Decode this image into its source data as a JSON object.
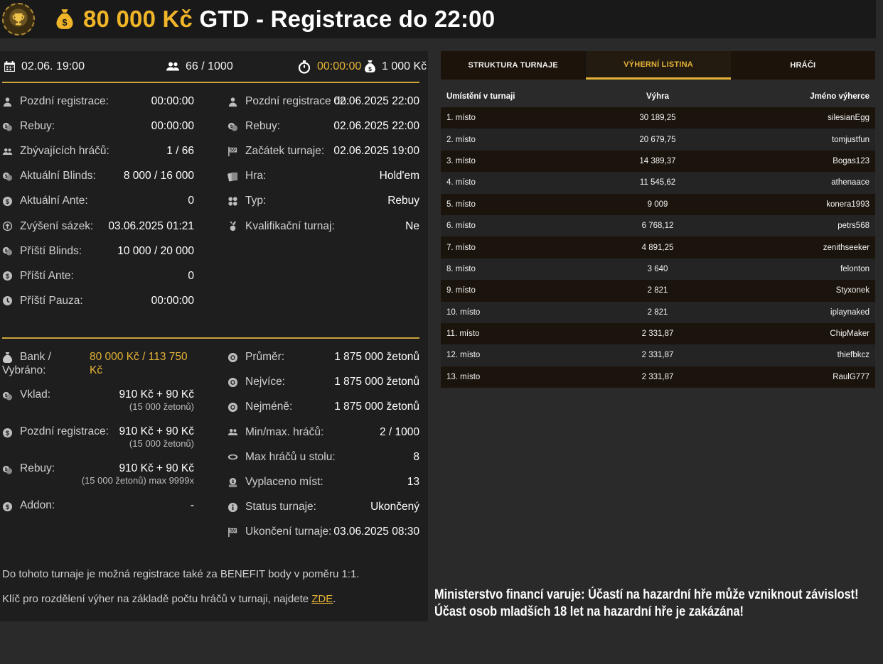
{
  "header": {
    "amount": "80 000 Kč",
    "rest": " GTD - Registrace do 22:00"
  },
  "summary": {
    "date": "02.06. 19:00",
    "players": "66 / 1000",
    "timer": "00:00:00",
    "buyin": "1 000 Kč"
  },
  "info_left": [
    {
      "icon": "person-icon",
      "label": "Pozdní registrace:",
      "value": "00:00:00"
    },
    {
      "icon": "coins-icon",
      "label": "Rebuy:",
      "value": "00:00:00"
    },
    {
      "icon": "users-icon",
      "label": "Zbývajících hráčů:",
      "value": "1 / 66"
    },
    {
      "icon": "coins-icon",
      "label": "Aktuální Blinds:",
      "value": "8 000 / 16 000"
    },
    {
      "icon": "coin-icon",
      "label": "Aktuální Ante:",
      "value": "0"
    },
    {
      "icon": "clock-up-icon",
      "label": "Zvýšení sázek:",
      "value": "03.06.2025 01:21"
    },
    {
      "icon": "coins-icon",
      "label": "Příští Blinds:",
      "value": "10 000 / 20 000"
    },
    {
      "icon": "coin-icon",
      "label": "Příští Ante:",
      "value": "0"
    },
    {
      "icon": "clock-icon",
      "label": "Příští Pauza:",
      "value": "00:00:00"
    }
  ],
  "info_right": [
    {
      "icon": "person-icon",
      "label": "Pozdní registrace do:",
      "value": "02.06.2025 22:00"
    },
    {
      "icon": "coins-icon",
      "label": "Rebuy:",
      "value": "02.06.2025 22:00"
    },
    {
      "icon": "flag-icon",
      "label": "Začátek turnaje:",
      "value": "02.06.2025 19:00"
    },
    {
      "icon": "cards-icon",
      "label": "Hra:",
      "value": "Hold'em"
    },
    {
      "icon": "suits-icon",
      "label": "Typ:",
      "value": "Rebuy"
    },
    {
      "icon": "medal-icon",
      "label": "Kvalifikační turnaj:",
      "value": "Ne"
    }
  ],
  "bank": {
    "label1": "Bank /",
    "label2": "Vybráno:",
    "value1": "80 000 Kč / 113 750",
    "value2": "Kč"
  },
  "fees": [
    {
      "icon": "coins-icon",
      "label": "Vklad:",
      "value": "910 Kč + 90 Kč",
      "sub": "(15 000 žetonů)"
    },
    {
      "icon": "coin-icon",
      "label": "Pozdní registrace:",
      "value": "910 Kč + 90 Kč",
      "sub": "(15 000 žetonů)"
    },
    {
      "icon": "coins-icon",
      "label": "Rebuy:",
      "value": "910 Kč + 90 Kč",
      "sub": "(15 000 žetonů) max 9999x"
    },
    {
      "icon": "coin-icon",
      "label": "Addon:",
      "value": "-",
      "sub": ""
    }
  ],
  "stats": [
    {
      "icon": "chip-icon",
      "label": "Průměr:",
      "value": "1 875 000 žetonů"
    },
    {
      "icon": "chip-icon",
      "label": "Nejvíce:",
      "value": "1 875 000 žetonů"
    },
    {
      "icon": "chip-icon",
      "label": "Nejméně:",
      "value": "1 875 000 žetonů"
    },
    {
      "icon": "users-icon",
      "label": "Min/max. hráčů:",
      "value": "2 / 1000"
    },
    {
      "icon": "table-icon",
      "label": "Max hráčů u stolu:",
      "value": "8"
    },
    {
      "icon": "payout-icon",
      "label": "Vyplaceno míst:",
      "value": "13"
    },
    {
      "icon": "info-icon",
      "label": "Status turnaje:",
      "value": "Ukončený"
    },
    {
      "icon": "flag-icon",
      "label": "Ukončení turnaje:",
      "value": "03.06.2025 08:30"
    }
  ],
  "notes": {
    "benefit": "Do tohoto turnaje je možná registrace také za BENEFIT body v poměru 1:1.",
    "key_text": "Klíč pro rozdělení výher na základě počtu hráčů v turnaji, najdete ",
    "key_link": "ZDE",
    "key_end": "."
  },
  "tabs": [
    "STRUKTURA TURNAJE",
    "VÝHERNÍ LISTINA",
    "HRÁČI"
  ],
  "table": {
    "headers": [
      "Umístění v turnaji",
      "Výhra",
      "Jméno výherce"
    ],
    "rows": [
      [
        "1. místo",
        "30 189,25",
        "silesianEgg"
      ],
      [
        "2. místo",
        "20 679,75",
        "tomjustfun"
      ],
      [
        "3. místo",
        "14 389,37",
        "Bogas123"
      ],
      [
        "4. místo",
        "11 545,62",
        "athenaace"
      ],
      [
        "5. místo",
        "9 009",
        "konera1993"
      ],
      [
        "6. místo",
        "6 768,12",
        "petrs568"
      ],
      [
        "7. místo",
        "4 891,25",
        "zenithseeker"
      ],
      [
        "8. místo",
        "3 640",
        "felonton"
      ],
      [
        "9. místo",
        "2 821",
        "Styxonek"
      ],
      [
        "10. místo",
        "2 821",
        "iplaynaked"
      ],
      [
        "11. místo",
        "2 331,87",
        "ChipMaker"
      ],
      [
        "12. místo",
        "2 331,87",
        "thiefbkcz"
      ],
      [
        "13. místo",
        "2 331,87",
        "RaulG777"
      ]
    ]
  },
  "warning": {
    "line1": "Ministerstvo financí varuje: Účastí na hazardní hře může vzniknout závislost!",
    "line2": "Účast osob mladších 18 let na hazardní hře je zakázána!"
  },
  "colors": {
    "accent": "#e5b336",
    "panel": "#1e1e1e",
    "background": "#2a2a2a"
  }
}
